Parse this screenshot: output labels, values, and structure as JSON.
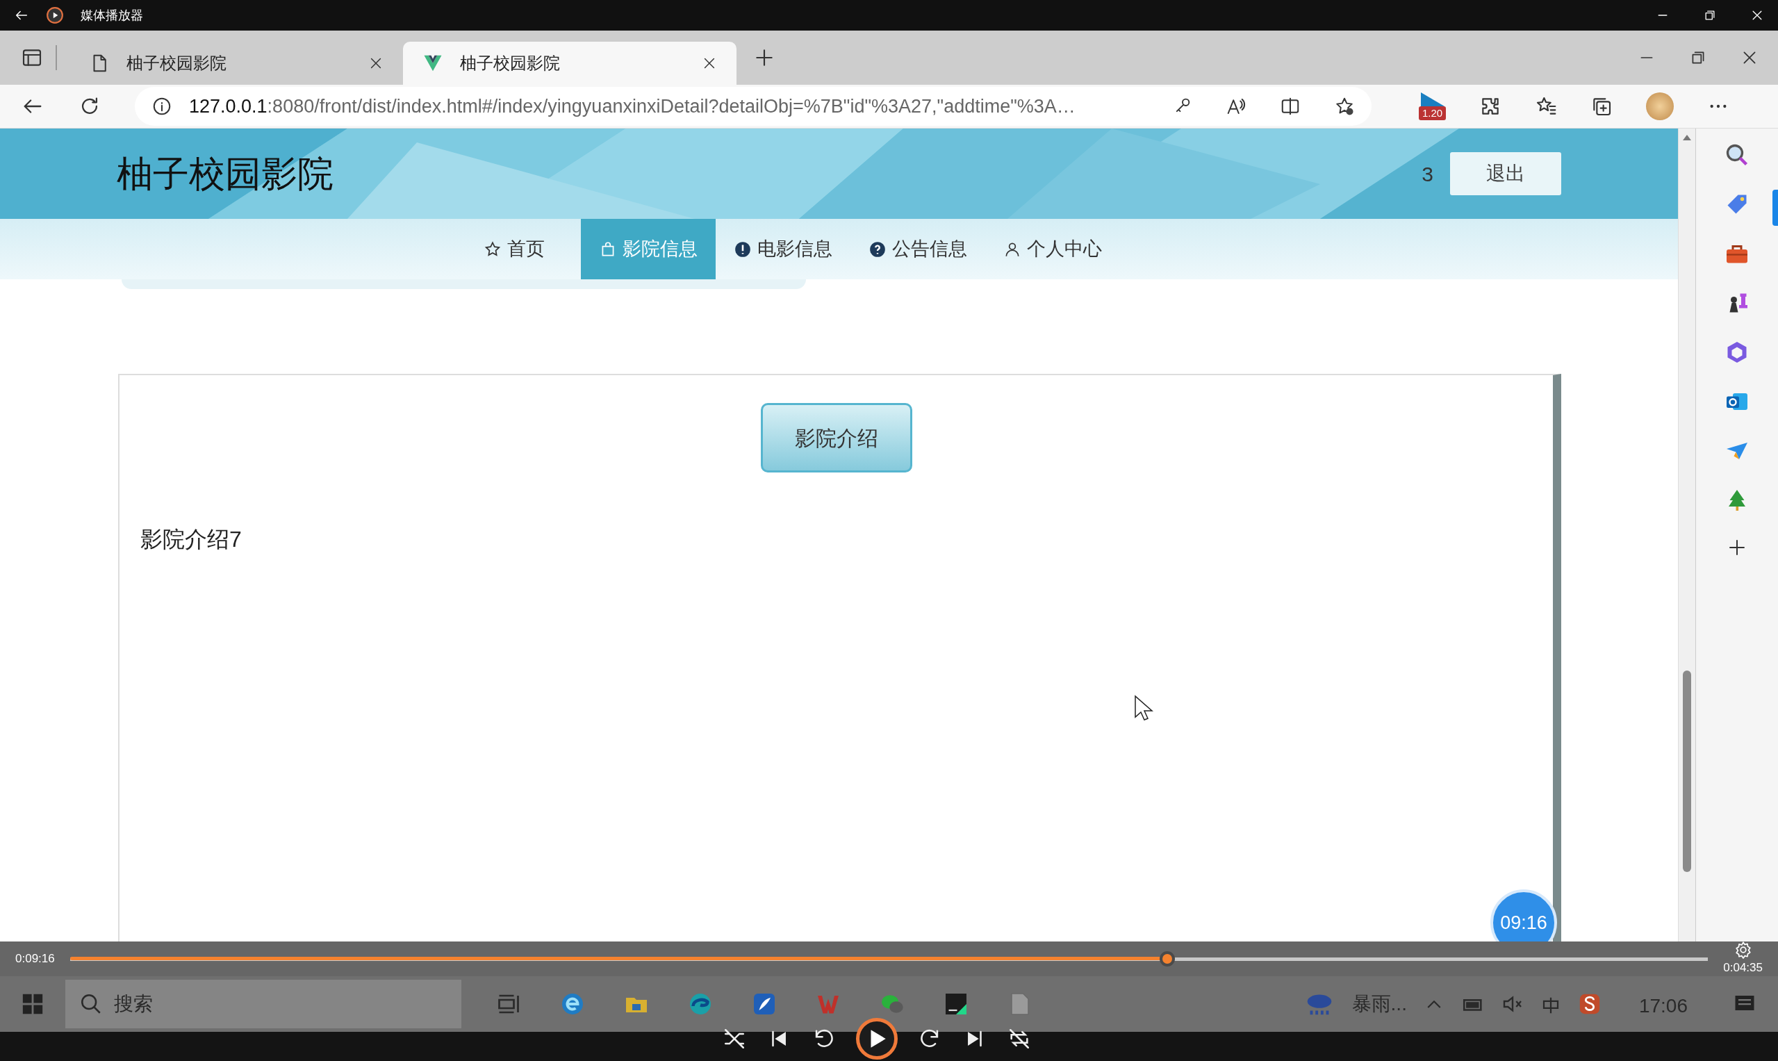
{
  "player": {
    "title": "媒体播放器",
    "elapsed": "0:09:16",
    "remaining": "0:04:35",
    "level": 0.67
  },
  "browser": {
    "tabs": [
      {
        "title": "柚子校园影院",
        "selected": false,
        "kind": "page"
      },
      {
        "title": "柚子校园影院",
        "selected": true,
        "kind": "vue"
      }
    ],
    "url_host": "127.0.0.1",
    "url_rest": ":8080/front/dist/index.html#/index/yingyuanxinxiDetail?detailObj=%7B\"id\"%3A27,\"addtime\"%3A…",
    "extension_badge": "1.20"
  },
  "site": {
    "title": "柚子校园影院",
    "user": "3",
    "logout": "退出",
    "nav": [
      {
        "label": "首页",
        "kind": "star",
        "selected": false
      },
      {
        "label": "影院信息",
        "kind": "bag",
        "selected": true
      },
      {
        "label": "电影信息",
        "kind": "alert",
        "selected": false
      },
      {
        "label": "公告信息",
        "kind": "help",
        "selected": false
      },
      {
        "label": "个人中心",
        "kind": "person",
        "selected": false
      }
    ],
    "section_button": "影院介绍",
    "content": "影院介绍7",
    "timer": "09:16"
  },
  "taskbar": {
    "search": "搜索",
    "weather": "暴雨...",
    "time": "17:06"
  }
}
